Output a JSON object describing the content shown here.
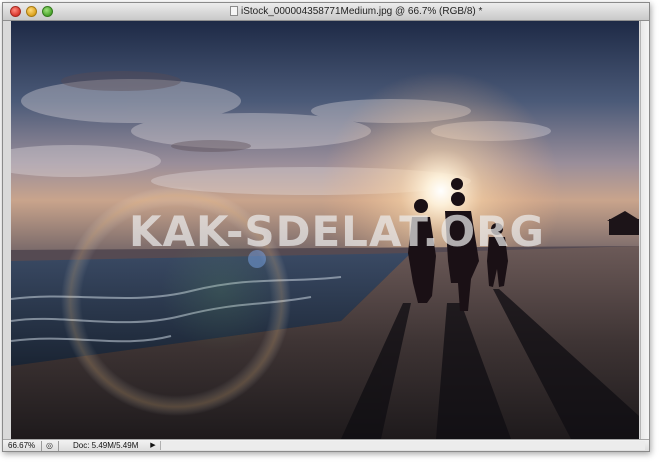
{
  "window": {
    "title": "iStock_000004358771Medium.jpg @ 66.7% (RGB/8) *"
  },
  "titlebar": {
    "buttons": [
      "close",
      "minimize",
      "zoom"
    ]
  },
  "canvas": {
    "watermark": "KAK-SDELAT.ORG"
  },
  "statusbar": {
    "zoom_value": "66.67%",
    "doc_info": "Doc: 5.49M/5.49M",
    "menu_arrow": "▶"
  },
  "colors": {
    "sky_top": "#2b3a5a",
    "sun": "#fff6e6",
    "sand": "#3a3030",
    "sea": "#1f3044"
  }
}
